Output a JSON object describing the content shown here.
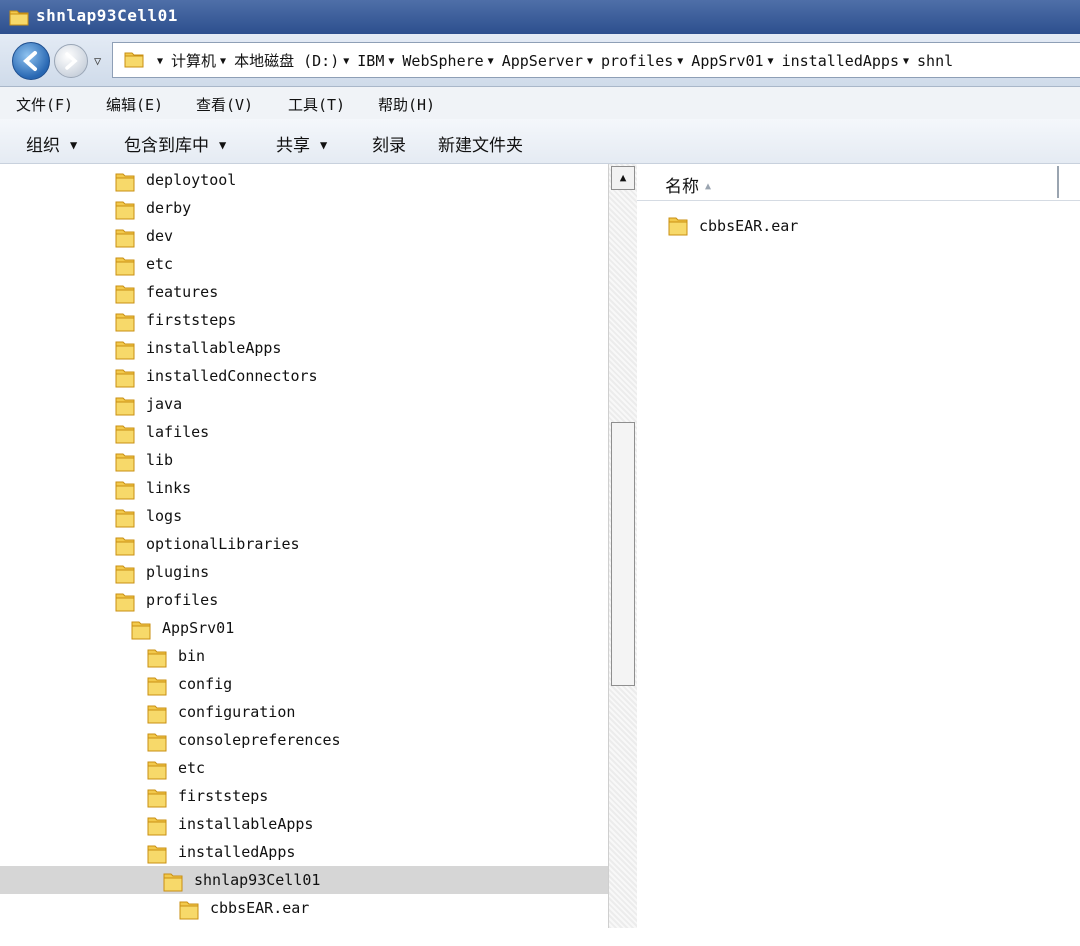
{
  "window": {
    "title": "shnlap93Cell01"
  },
  "address": {
    "crumbs": [
      "计算机",
      "本地磁盘 (D:)",
      "IBM",
      "WebSphere",
      "AppServer",
      "profiles",
      "AppSrv01",
      "installedApps",
      "shnl"
    ]
  },
  "menu": {
    "file": "文件(F)",
    "edit": "编辑(E)",
    "view": "查看(V)",
    "tools": "工具(T)",
    "help": "帮助(H)"
  },
  "commands": {
    "organize": "组织",
    "include_library": "包含到库中",
    "share": "共享",
    "burn": "刻录",
    "new_folder": "新建文件夹"
  },
  "tree": [
    {
      "label": "deploytool",
      "depth": 0
    },
    {
      "label": "derby",
      "depth": 0
    },
    {
      "label": "dev",
      "depth": 0
    },
    {
      "label": "etc",
      "depth": 0
    },
    {
      "label": "features",
      "depth": 0
    },
    {
      "label": "firststeps",
      "depth": 0
    },
    {
      "label": "installableApps",
      "depth": 0
    },
    {
      "label": "installedConnectors",
      "depth": 0
    },
    {
      "label": "java",
      "depth": 0
    },
    {
      "label": "lafiles",
      "depth": 0
    },
    {
      "label": "lib",
      "depth": 0
    },
    {
      "label": "links",
      "depth": 0
    },
    {
      "label": "logs",
      "depth": 0
    },
    {
      "label": "optionalLibraries",
      "depth": 0
    },
    {
      "label": "plugins",
      "depth": 0
    },
    {
      "label": "profiles",
      "depth": 0
    },
    {
      "label": "AppSrv01",
      "depth": 1
    },
    {
      "label": "bin",
      "depth": 2
    },
    {
      "label": "config",
      "depth": 2
    },
    {
      "label": "configuration",
      "depth": 2
    },
    {
      "label": "consolepreferences",
      "depth": 2
    },
    {
      "label": "etc",
      "depth": 2
    },
    {
      "label": "firststeps",
      "depth": 2
    },
    {
      "label": "installableApps",
      "depth": 2
    },
    {
      "label": "installedApps",
      "depth": 2
    },
    {
      "label": "shnlap93Cell01",
      "depth": 3,
      "selected": true
    },
    {
      "label": "cbbsEAR.ear",
      "depth": 4
    }
  ],
  "list": {
    "column_name": "名称",
    "items": [
      {
        "label": "cbbsEAR.ear"
      }
    ]
  },
  "colors": {
    "folder": "#f2c94c",
    "folder_dark": "#c98f12",
    "selection": "#d6d6d6",
    "titlebar": "#3a5a96"
  },
  "icons": {
    "folder": "folder-icon",
    "back": "back-arrow-icon",
    "forward": "forward-arrow-icon"
  }
}
